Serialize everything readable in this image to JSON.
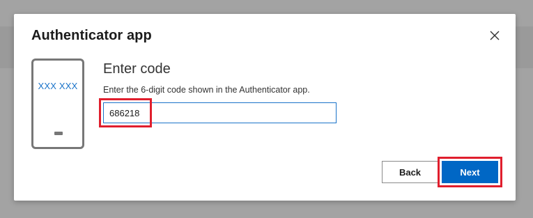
{
  "dialog": {
    "title": "Authenticator app",
    "close_icon": "close-icon"
  },
  "illustration": {
    "icon": "phone-icon",
    "code_text": "XXX XXX"
  },
  "content": {
    "heading": "Enter code",
    "instructions": "Enter the 6-digit code shown in the Authenticator app.",
    "code_input_value": "686218",
    "code_input_placeholder": ""
  },
  "actions": {
    "back_label": "Back",
    "next_label": "Next"
  },
  "colors": {
    "accent": "#0067c5",
    "highlight": "#e01e2d",
    "phone_code": "#1a73c9"
  }
}
